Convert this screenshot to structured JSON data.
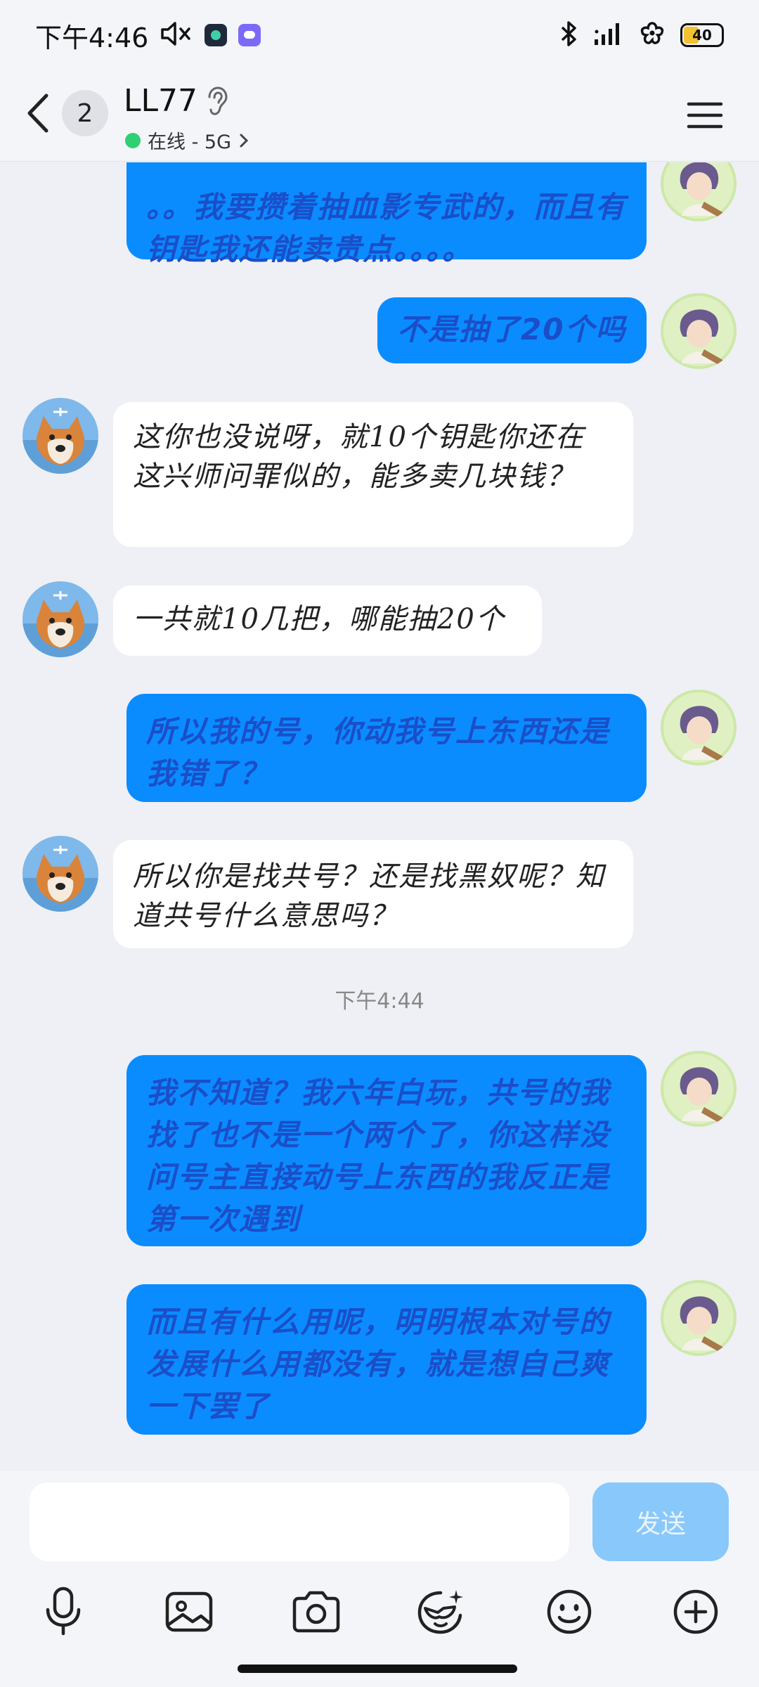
{
  "status": {
    "time": "下午4:46",
    "battery": "40"
  },
  "header": {
    "back_count": "2",
    "contact_name": "LL77",
    "online_status": "在线 - 5G"
  },
  "messages": [
    {
      "side": "out",
      "text": "。。我要攒着抽血影专武的，而且有钥匙我还能卖贵点。。。。"
    },
    {
      "side": "out",
      "text": "不是抽了20个吗"
    },
    {
      "side": "in",
      "text": "这你也没说呀，就10个钥匙你还在这兴师问罪似的，能多卖几块钱？"
    },
    {
      "side": "in",
      "text": "一共就10几把，哪能抽20个"
    },
    {
      "side": "out",
      "text": "所以我的号，你动我号上东西还是我错了？"
    },
    {
      "side": "in",
      "text": "所以你是找共号？还是找黑奴呢？知道共号什么意思吗？"
    },
    {
      "side": "out",
      "text": "我不知道？我六年白玩，共号的我找了也不是一个两个了，你这样没问号主直接动号上东西的我反正是第一次遇到"
    },
    {
      "side": "out",
      "text": "而且有什么用呢，明明根本对号的发展什么用都没有，就是想自己爽一下罢了"
    }
  ],
  "timestamp": "下午4:44",
  "input": {
    "placeholder": "",
    "send_label": "发送"
  },
  "toolbar": [
    "microphone-icon",
    "image-icon",
    "camera-icon",
    "sticker-icon",
    "emoji-icon",
    "plus-icon"
  ],
  "colors": {
    "outgoing_bubble": "#0a8cff",
    "outgoing_text": "#1b4ec8",
    "incoming_bubble": "#ffffff",
    "send_button": "#89c8fb"
  }
}
